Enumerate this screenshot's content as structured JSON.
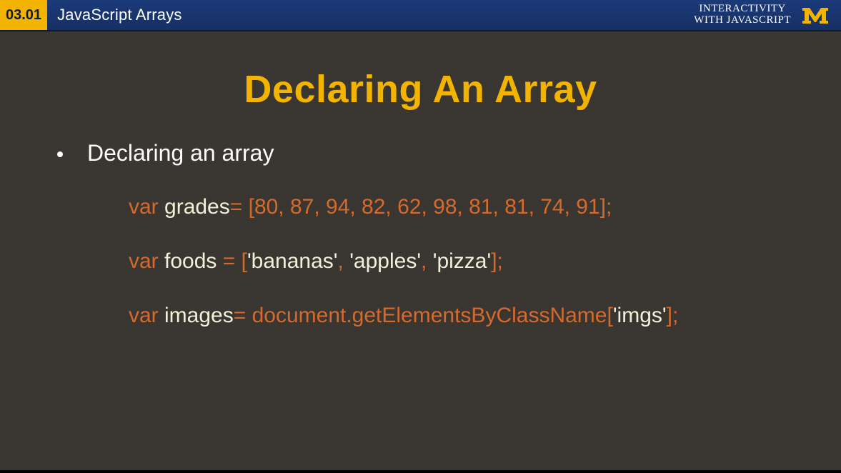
{
  "header": {
    "lesson_number": "03.01",
    "lesson_title": "JavaScript Arrays",
    "course_line1": "INTERACTIVITY",
    "course_line2": "WITH JAVASCRIPT"
  },
  "slide": {
    "title": "Declaring An Array",
    "bullet": "Declaring an array",
    "code1": {
      "kw": "var ",
      "ident": "grades",
      "rest": "= [80, 87, 94, 82, 62, 98, 81, 81, 74, 91];"
    },
    "code2": {
      "kw": "var ",
      "ident": "foods ",
      "rest_a": "= [",
      "s1": "'bananas'",
      "c1": ", ",
      "s2": "'apples'",
      "c2": ", ",
      "s3": "'pizza'",
      "rest_b": "];"
    },
    "code3": {
      "kw": "var ",
      "ident": "images",
      "rest_a": "= document.getElementsByClassName[",
      "s1": "'imgs'",
      "rest_b": "];"
    }
  }
}
